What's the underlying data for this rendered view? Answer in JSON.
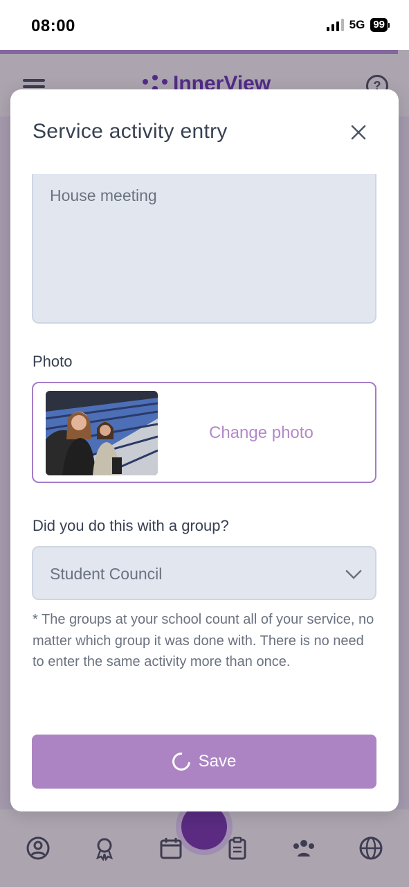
{
  "status_bar": {
    "time": "08:00",
    "network": "5G",
    "battery": "99"
  },
  "app": {
    "brand_name": "InnerView",
    "help_symbol": "?",
    "accent_color": "#b48fe0",
    "brand_color": "#5b21b6",
    "tab_icons": [
      "profile-icon",
      "award-icon",
      "calendar-icon",
      "clipboard-icon",
      "group-icon",
      "globe-icon"
    ]
  },
  "modal": {
    "title": "Service activity entry",
    "description_value": "House meeting",
    "photo_label": "Photo",
    "change_photo_label": "Change photo",
    "group_question": "Did you do this with a group?",
    "group_selected": "Student Council",
    "group_note": "* The groups at your school count all of your service, no matter which group it was done with. There is no need to enter the same activity more than once.",
    "save_label": "Save",
    "save_color": "#ac84c3"
  }
}
